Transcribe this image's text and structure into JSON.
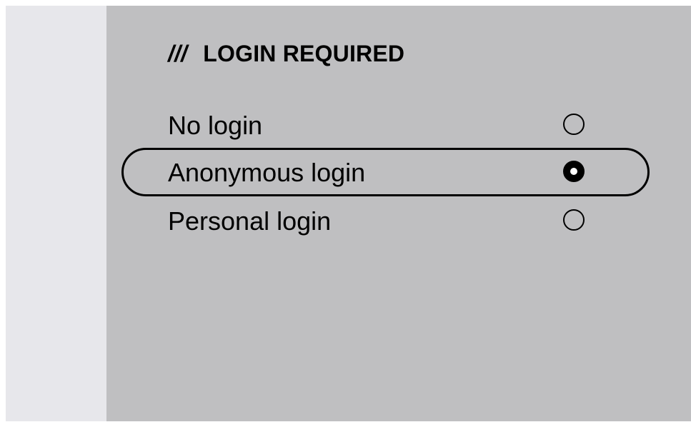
{
  "header": {
    "mark": "///",
    "title": "LOGIN REQUIRED"
  },
  "options": [
    {
      "label": "No login",
      "selected": false
    },
    {
      "label": "Anonymous login",
      "selected": true
    },
    {
      "label": "Personal login",
      "selected": false
    }
  ],
  "focused_option": "Anonymous login",
  "colors": {
    "side_panel": "#e7e7eb",
    "main_panel": "#bfbfc1",
    "text": "#000000"
  }
}
